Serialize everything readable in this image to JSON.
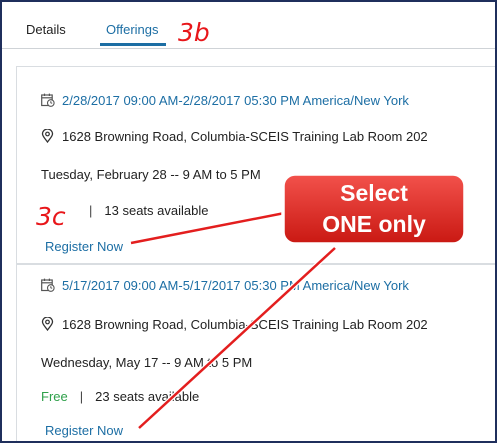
{
  "tabs": {
    "details": "Details",
    "offerings": "Offerings"
  },
  "annotations": {
    "step_tab": "3b",
    "step_register": "3c",
    "callout": [
      "Select",
      "ONE only"
    ]
  },
  "offerings": [
    {
      "datetime": "2/28/2017 09:00 AM-2/28/2017 05:30 PM America/New York",
      "location": "1628 Browning Road, Columbia-SCEIS Training Lab Room 202",
      "schedule": "Tuesday, February 28 -- 9 AM to 5 PM",
      "price": "",
      "seats": "13 seats available",
      "register": "Register Now"
    },
    {
      "datetime": "5/17/2017 09:00 AM-5/17/2017 05:30 PM America/New York",
      "location": "1628 Browning Road, Columbia-SCEIS Training Lab Room 202",
      "schedule": "Wednesday, May 17 -- 9 AM to 5 PM",
      "price": "Free",
      "seats": "23 seats available",
      "register": "Register Now"
    }
  ],
  "colors": {
    "link": "#1c6ea4",
    "annotation_red": "#e8161a",
    "frame": "#1f2f5c",
    "free": "#2ea04a"
  }
}
